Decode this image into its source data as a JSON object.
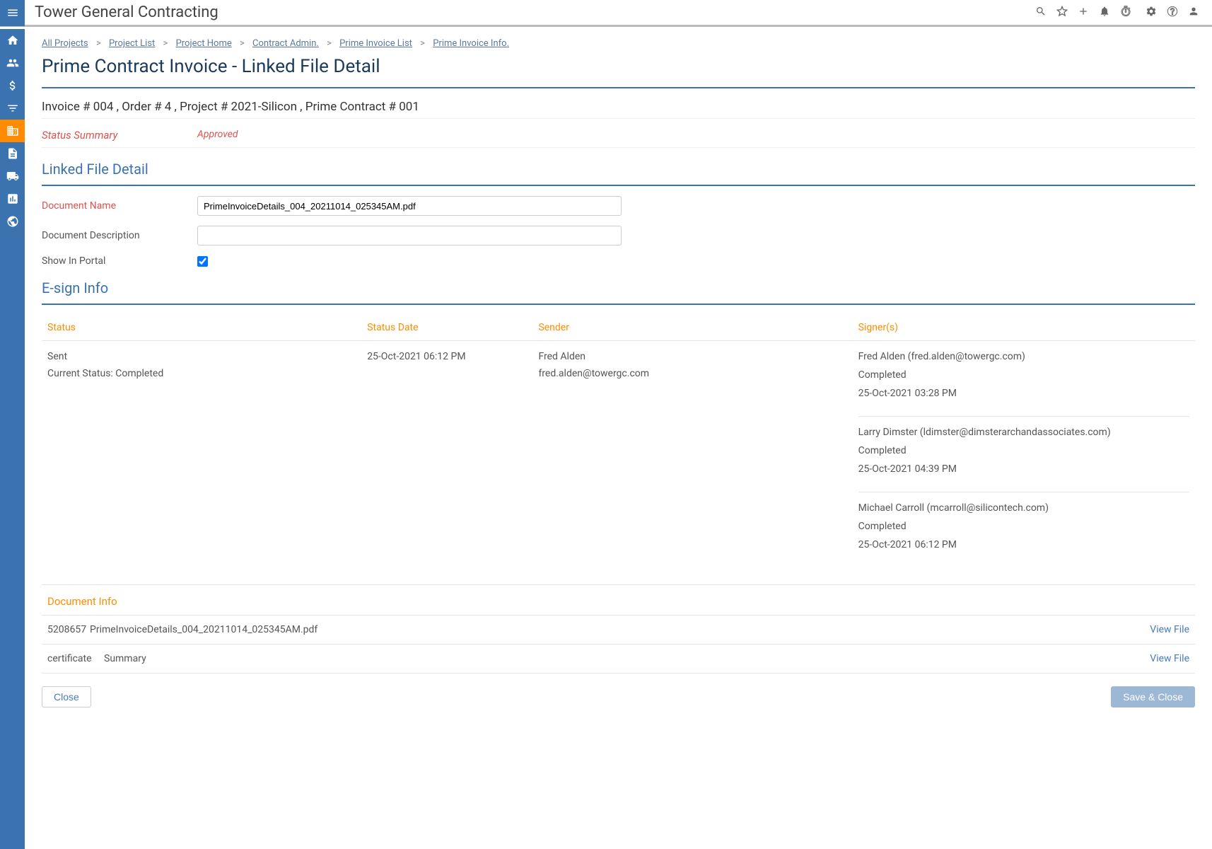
{
  "header": {
    "company": "Tower General Contracting"
  },
  "breadcrumb": {
    "items": [
      {
        "label": "All Projects"
      },
      {
        "label": "Project List"
      },
      {
        "label": "Project Home"
      },
      {
        "label": "Contract Admin."
      },
      {
        "label": "Prime Invoice List"
      },
      {
        "label": "Prime Invoice Info."
      }
    ]
  },
  "page": {
    "title": "Prime Contract Invoice - Linked File Detail",
    "subtitle": "Invoice # 004 , Order # 4 , Project # 2021-Silicon , Prime Contract # 001"
  },
  "status": {
    "label": "Status Summary",
    "value": "Approved"
  },
  "sections": {
    "linked_file": "Linked File Detail",
    "esign": "E-sign Info",
    "doc_info": "Document Info"
  },
  "form": {
    "doc_name_label": "Document Name",
    "doc_name_value": "PrimeInvoiceDetails_004_20211014_025345AM.pdf",
    "doc_desc_label": "Document Description",
    "doc_desc_value": "",
    "show_portal_label": "Show In Portal",
    "show_portal_checked": true
  },
  "esign": {
    "headers": {
      "status": "Status",
      "status_date": "Status Date",
      "sender": "Sender",
      "signers": "Signer(s)"
    },
    "row": {
      "status_line1": "Sent",
      "status_line2": "Current Status: Completed",
      "status_date": "25-Oct-2021 06:12 PM",
      "sender_name": "Fred Alden",
      "sender_email": "fred.alden@towergc.com",
      "signers": [
        {
          "name_email": "Fred Alden (fred.alden@towergc.com)",
          "status": "Completed",
          "date": "25-Oct-2021 03:28 PM"
        },
        {
          "name_email": "Larry Dimster (ldimster@dimsterarchandassociates.com)",
          "status": "Completed",
          "date": "25-Oct-2021 04:39 PM"
        },
        {
          "name_email": "Michael Carroll (mcarroll@silicontech.com)",
          "status": "Completed",
          "date": "25-Oct-2021 06:12 PM"
        }
      ]
    }
  },
  "doc_info": {
    "rows": [
      {
        "id": "5208657",
        "name": "PrimeInvoiceDetails_004_20211014_025345AM.pdf",
        "action": "View File"
      },
      {
        "id": "certificate",
        "name": "Summary",
        "action": "View File"
      }
    ]
  },
  "buttons": {
    "close": "Close",
    "save": "Save & Close"
  }
}
